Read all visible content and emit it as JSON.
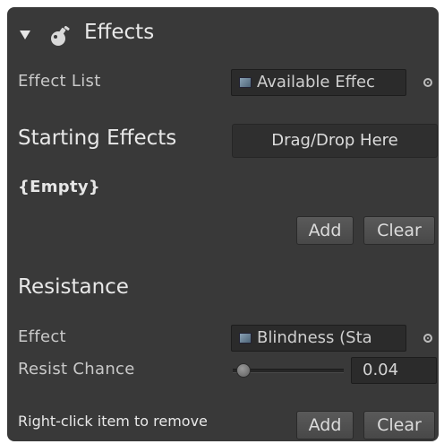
{
  "header": {
    "title": "Effects"
  },
  "effect_list": {
    "label": "Effect List",
    "value": "Available Effec"
  },
  "starting_effects": {
    "label": "Starting Effects",
    "drop_label": "Drag/Drop Here",
    "empty_text": "{Empty}",
    "add_label": "Add",
    "clear_label": "Clear"
  },
  "resistance": {
    "heading": "Resistance",
    "effect_label": "Effect",
    "effect_value": "Blindness (Sta",
    "resist_label": "Resist Chance",
    "resist_value": "0.04",
    "resist_fraction": 0.04,
    "hint": "Right-click item to remove",
    "add_label": "Add",
    "clear_label": "Clear"
  }
}
